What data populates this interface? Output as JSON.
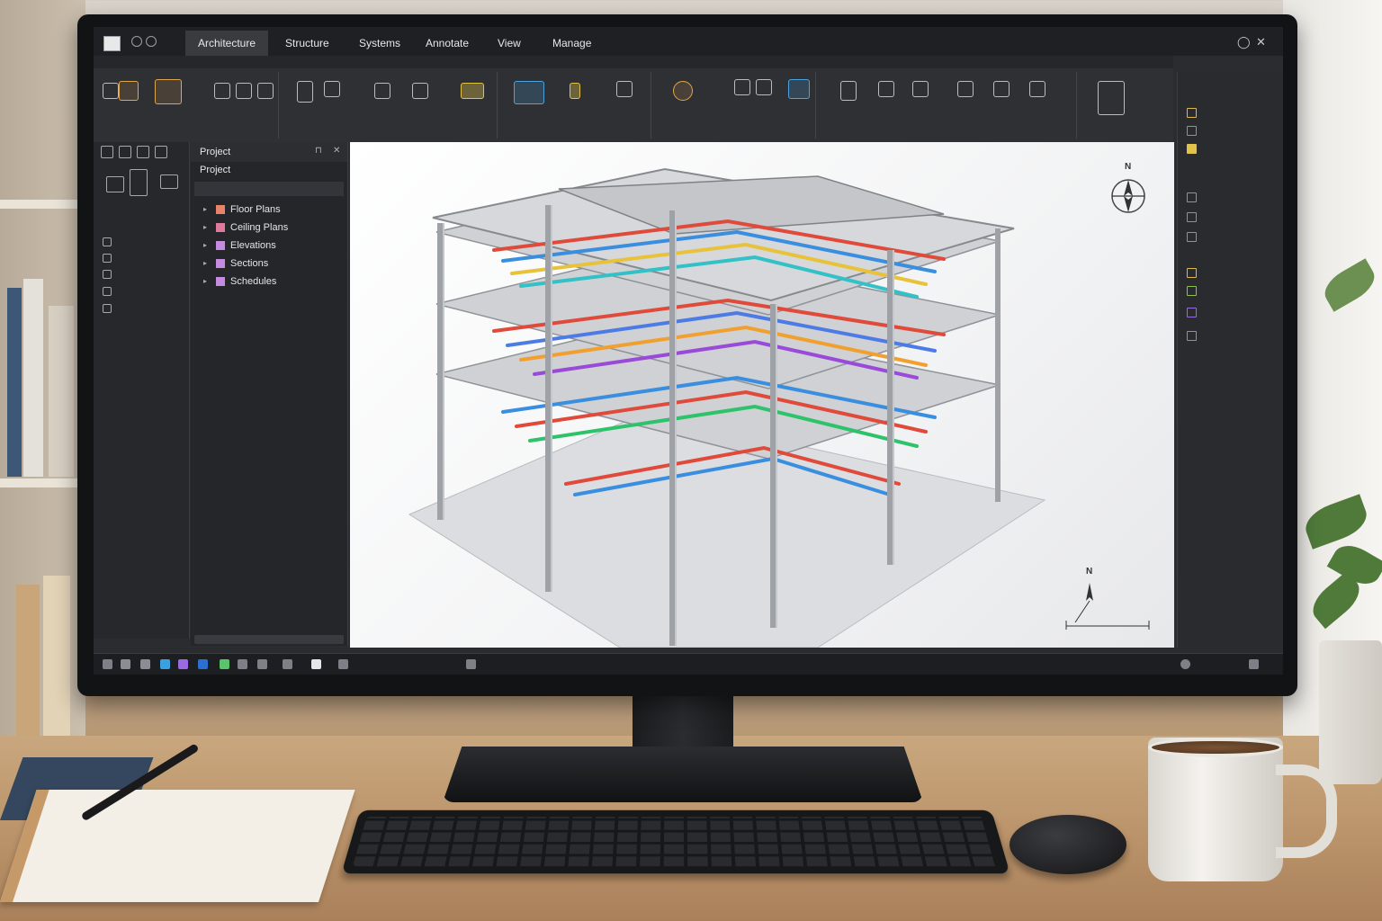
{
  "app": {
    "ribbon_tabs": [
      "Architecture",
      "Structure",
      "Systems",
      "Annotate",
      "View",
      "Manage"
    ],
    "active_tab": "Architecture"
  },
  "project_browser": {
    "header": "Project",
    "title": "Project",
    "items": [
      {
        "label": "Floor Plans",
        "color": "#e8836a"
      },
      {
        "label": "Ceiling Plans",
        "color": "#e07a9c"
      },
      {
        "label": "Elevations",
        "color": "#c58be0"
      },
      {
        "label": "Sections",
        "color": "#c58be0"
      },
      {
        "label": "Schedules",
        "color": "#c58be0"
      }
    ]
  },
  "viewport": {
    "north_label_top": "N",
    "north_label_bottom": "N"
  },
  "colors": {
    "ui_dark": "#2b2c30",
    "active_tab": "#3a3b3f",
    "accent_orange": "#e0a64a",
    "accent_blue": "#4aa3e0"
  }
}
